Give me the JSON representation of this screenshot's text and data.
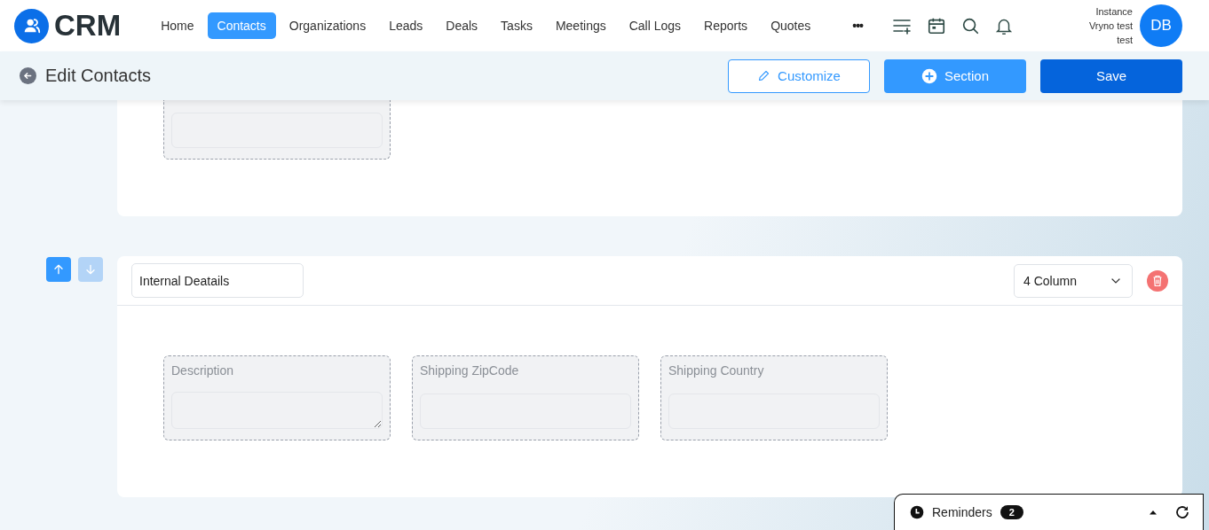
{
  "app": {
    "logo_text": "CRM"
  },
  "nav": [
    {
      "label": "Home",
      "selected": false
    },
    {
      "label": "Contacts",
      "selected": true
    },
    {
      "label": "Organizations",
      "selected": false
    },
    {
      "label": "Leads",
      "selected": false
    },
    {
      "label": "Deals",
      "selected": false
    },
    {
      "label": "Tasks",
      "selected": false
    },
    {
      "label": "Meetings",
      "selected": false
    },
    {
      "label": "Call Logs",
      "selected": false
    },
    {
      "label": "Reports",
      "selected": false
    },
    {
      "label": "Quotes",
      "selected": false
    }
  ],
  "more": "•••",
  "user": {
    "lines": [
      "Instance",
      "Vryno test",
      "test"
    ],
    "initials": "DB"
  },
  "page": {
    "title": "Edit Contacts",
    "buttons": [
      {
        "kind": "outline",
        "label": "Customize"
      },
      {
        "kind": "add",
        "label": "Section"
      },
      {
        "kind": "primary",
        "label": "Save"
      }
    ]
  },
  "sections": [
    {
      "fields": [
        {
          "kind": "input"
        }
      ]
    },
    {
      "title": "Internal Deatails",
      "columns": "4 Column",
      "move_up": {
        "disabled": false
      },
      "move_down": {
        "disabled": true
      },
      "fields": [
        {
          "label": "Description",
          "kind": "textarea"
        },
        {
          "label": "Shipping ZipCode",
          "kind": "input"
        },
        {
          "label": "Shipping Country",
          "kind": "input"
        }
      ]
    }
  ],
  "reminders": {
    "label": "Reminders",
    "count": "2"
  }
}
